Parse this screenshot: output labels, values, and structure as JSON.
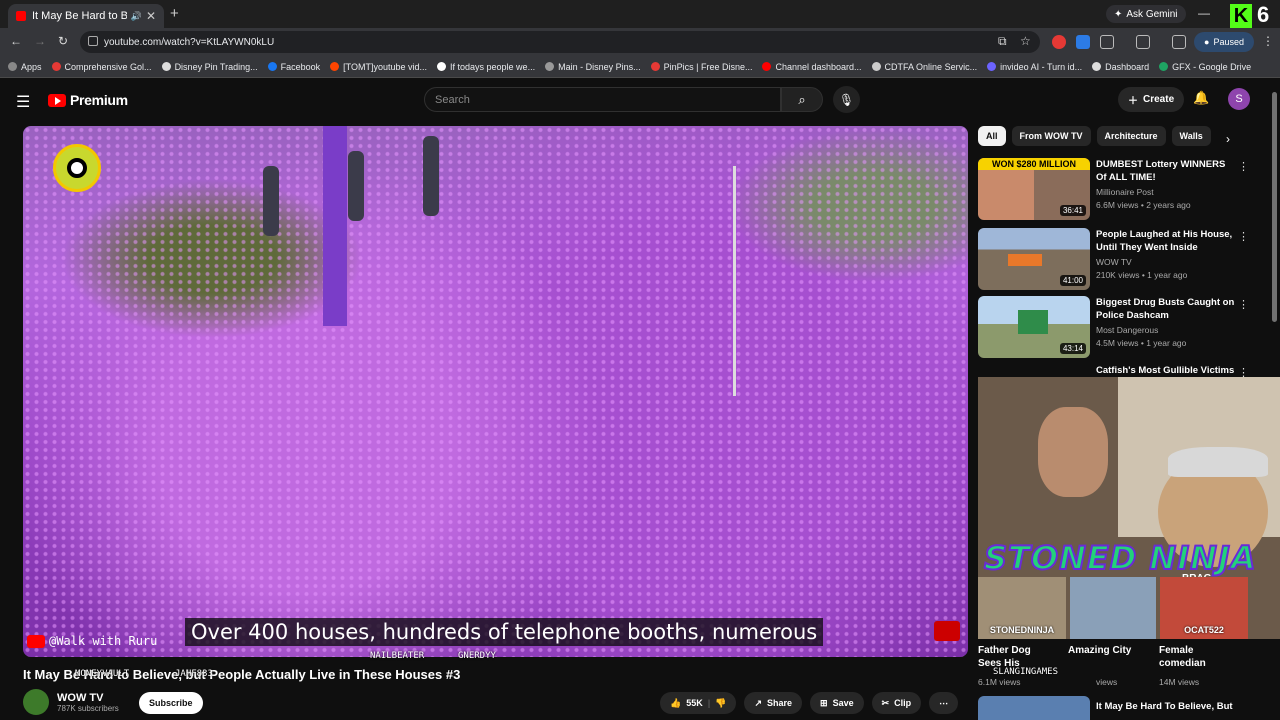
{
  "browser": {
    "tab_title": "It May Be Hard to Believe, b",
    "new_tab": "+",
    "ask_gemini": "Ask Gemini",
    "url": "youtube.com/watch?v=KtLAYWN0kLU",
    "paused": "Paused",
    "profile_number": "6",
    "bookmarks": [
      {
        "label": "Apps",
        "color": "#888888"
      },
      {
        "label": "Comprehensive Gol...",
        "color": "#e53935"
      },
      {
        "label": "Disney Pin Trading...",
        "color": "#dddddd"
      },
      {
        "label": "Facebook",
        "color": "#1877f2"
      },
      {
        "label": "[TOMT]youtube vid...",
        "color": "#ff4500"
      },
      {
        "label": "If todays people we...",
        "color": "#ffffff"
      },
      {
        "label": "Main - Disney Pins...",
        "color": "#999999"
      },
      {
        "label": "PinPics | Free Disne...",
        "color": "#e53935"
      },
      {
        "label": "Channel dashboard...",
        "color": "#ff0000"
      },
      {
        "label": "CDTFA Online Servic...",
        "color": "#cccccc"
      },
      {
        "label": "invideo AI - Turn id...",
        "color": "#6c63ff"
      },
      {
        "label": "Dashboard",
        "color": "#dddddd"
      },
      {
        "label": "GFX - Google Drive",
        "color": "#1fa463"
      }
    ]
  },
  "youtube": {
    "logo_text": "Premium",
    "search_placeholder": "Search",
    "create": "Create",
    "avatar_letter": "S"
  },
  "video": {
    "caption": "Over 400 houses, hundreds of telephone booths, numerous",
    "watermark": "@Walk with Ruru",
    "title": "It May Be Hard to Believe, but People Actually Live in These Houses #3",
    "channel": "WOW TV",
    "subscribers": "787K subscribers",
    "subscribe": "Subscribe",
    "likes": "55K",
    "share": "Share",
    "save": "Save",
    "clip": "Clip",
    "overlay_names": [
      "MONEYVAULT",
      "JAHF833",
      "NAILBEATER",
      "GNERDYY"
    ]
  },
  "sidebar": {
    "chips": [
      "All",
      "From WOW TV",
      "Architecture",
      "Walls"
    ],
    "recs": [
      {
        "title": "DUMBEST Lottery WINNERS Of ALL TIME!",
        "channel": "Millionaire Post",
        "meta": "6.6M views • 2 years ago",
        "duration": "36:41",
        "thumb_text": "WON $280 MILLION"
      },
      {
        "title": "People Laughed at His House, Until They Went Inside",
        "channel": "WOW TV",
        "meta": "210K views • 1 year ago",
        "duration": "41:00"
      },
      {
        "title": "Biggest Drug Busts Caught on Police Dashcam",
        "channel": "Most Dangerous",
        "meta": "4.5M views • 1 year ago",
        "duration": "43:14"
      },
      {
        "title": "Catfish's Most Gullible Victims"
      }
    ],
    "webcam": {
      "title": "STONED NINJA",
      "brag": "BRAG",
      "sub_names": [
        "STONEDNINJA",
        "",
        "OCAT522"
      ],
      "player_name": "SLANGINGAMES"
    },
    "bottom_recs": [
      {
        "title": "Father Dog Sees His",
        "meta": "6.1M views"
      },
      {
        "title": "Amazing City",
        "meta": "views"
      },
      {
        "title": "Female comedian",
        "meta": "14M views"
      }
    ],
    "last_rec": "It May Be Hard To Believe, But"
  }
}
